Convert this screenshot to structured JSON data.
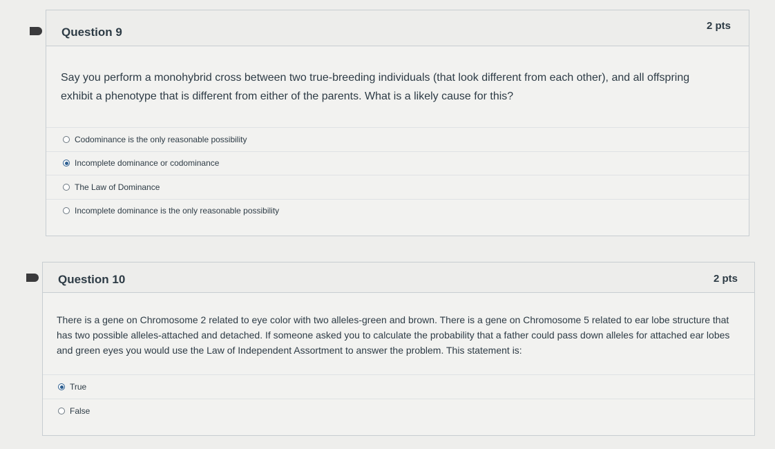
{
  "questions": [
    {
      "title": "Question 9",
      "points": "2 pts",
      "text": "Say you perform a monohybrid cross between two true-breeding individuals (that look different from each other), and all offspring exhibit a phenotype that is different from either of the parents.   What is a likely cause for this?",
      "answers": [
        {
          "label": "Codominance is the only reasonable possibility",
          "selected": false
        },
        {
          "label": "Incomplete dominance or codominance",
          "selected": true
        },
        {
          "label": "The Law of Dominance",
          "selected": false
        },
        {
          "label": "Incomplete dominance is the only reasonable possibility",
          "selected": false
        }
      ]
    },
    {
      "title": "Question 10",
      "points": "2 pts",
      "text": "There is a gene on Chromosome 2 related to eye color with two alleles-green and brown. There is a gene on Chromosome 5 related to ear lobe structure that has two possible alleles-attached and detached. If someone asked you to calculate the probability that a father could pass down alleles for attached ear lobes and green eyes you would use the Law of Independent Assortment to answer the problem. This statement is:",
      "answers": [
        {
          "label": "True",
          "selected": true
        },
        {
          "label": "False",
          "selected": false
        }
      ]
    }
  ],
  "colors": {
    "page_background": "#eeeeec",
    "text": "#2d3b45",
    "radio_selected": "#2b5d8f",
    "flag": "#3a3a3c"
  }
}
